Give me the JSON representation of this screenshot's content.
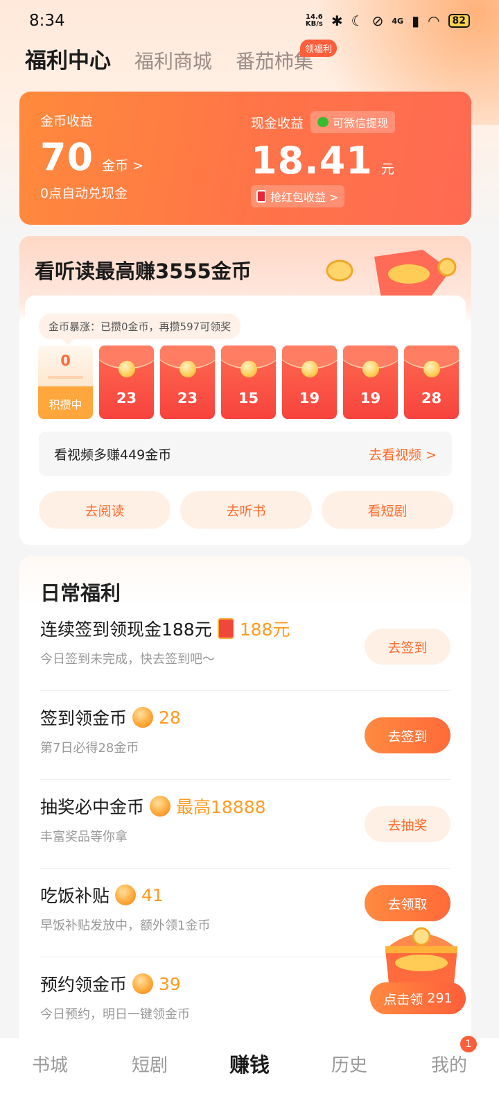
{
  "status_bar": {
    "time": "8:34",
    "net_speed_value": "14.6",
    "net_speed_unit": "KB/s",
    "network": "4G",
    "battery": "82"
  },
  "top_tabs": [
    {
      "label": "福利中心"
    },
    {
      "label": "福利商城"
    },
    {
      "label": "番茄柿集",
      "badge": "领福利"
    }
  ],
  "earnings": {
    "coin_label": "金币收益",
    "coin_value": "70",
    "coin_unit": "金币 >",
    "coin_sub": "0点自动兑现金",
    "cash_label": "现金收益",
    "wechat_chip": "可微信提现",
    "cash_value": "18.41",
    "cash_unit": "元",
    "redpack_chip": "抢红包收益 >"
  },
  "reading": {
    "title": "看听读最高赚3555金币",
    "tip": "金币暴涨：已攒0金币，再攒597可领奖",
    "current_pack": {
      "value": "0",
      "label": "积攒中"
    },
    "packs": [
      "23",
      "23",
      "15",
      "19",
      "19",
      "28"
    ],
    "video_text": "看视频多赚449金币",
    "video_link": "去看视频 >",
    "actions": [
      "去阅读",
      "去听书",
      "看短剧"
    ]
  },
  "daily": {
    "title": "日常福利",
    "tasks": [
      {
        "title": "连续签到领现金188元",
        "reward": "188元",
        "sub": "今日签到未完成，快去签到吧～",
        "button": "去签到"
      },
      {
        "title": "签到领金币",
        "reward": "28",
        "sub": "第7日必得28金币",
        "button": "去签到"
      },
      {
        "title": "抽奖必中金币",
        "reward": "最高18888",
        "sub": "丰富奖品等你拿",
        "button": "去抽奖"
      },
      {
        "title": "吃饭补贴",
        "reward": "41",
        "sub": "早饭补贴发放中，额外领1金币",
        "button": "去领取"
      },
      {
        "title": "预约领金币",
        "reward": "39",
        "sub": "今日预约，明日一键领金币",
        "button": ""
      }
    ]
  },
  "floating": {
    "label": "点击领",
    "value": "291"
  },
  "bottom_nav": [
    {
      "label": "书城"
    },
    {
      "label": "短剧"
    },
    {
      "label": "赚钱"
    },
    {
      "label": "历史"
    },
    {
      "label": "我的",
      "badge": "1"
    }
  ]
}
